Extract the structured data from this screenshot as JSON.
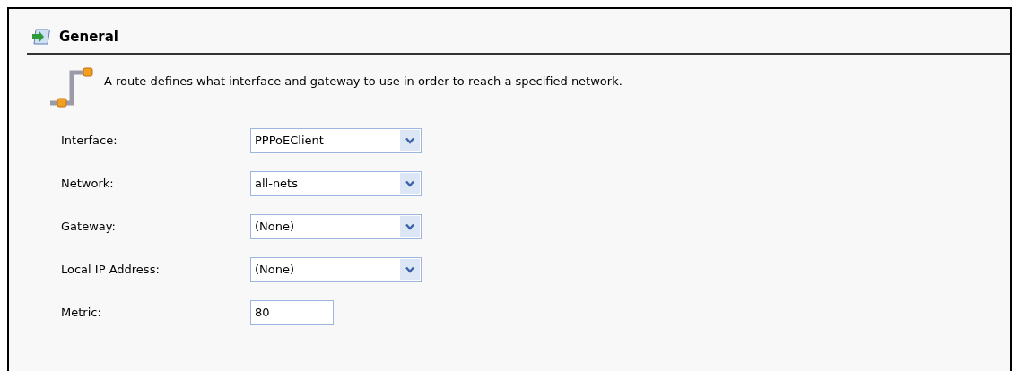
{
  "section": {
    "title": "General"
  },
  "description": "A route defines what interface and gateway to use in order to reach a specified network.",
  "fields": [
    {
      "label": "Interface:",
      "kind": "select",
      "value": "PPPoEClient"
    },
    {
      "label": "Network:",
      "kind": "select",
      "value": "all-nets"
    },
    {
      "label": "Gateway:",
      "kind": "select",
      "value": "(None)"
    },
    {
      "label": "Local IP Address:",
      "kind": "select",
      "value": "(None)"
    },
    {
      "label": "Metric:",
      "kind": "text",
      "value": "80"
    }
  ]
}
